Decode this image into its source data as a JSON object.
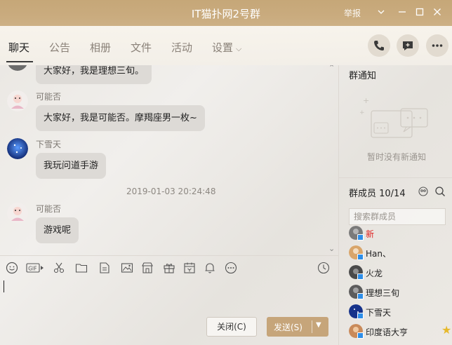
{
  "window": {
    "title": "IT猫扑网2号群",
    "report_label": "举报",
    "accent": "#c6a778"
  },
  "tabs": [
    {
      "label": "聊天",
      "active": true
    },
    {
      "label": "公告"
    },
    {
      "label": "相册"
    },
    {
      "label": "文件"
    },
    {
      "label": "活动"
    },
    {
      "label": "设置"
    }
  ],
  "header_actions": [
    "phone-icon",
    "add-chat-icon",
    "more-icon"
  ],
  "messages": [
    {
      "sender": "",
      "text": "大家好，我是理想三旬。"
    },
    {
      "sender": "可能否",
      "text": "大家好，我是可能否。摩羯座男一枚~"
    },
    {
      "sender": "下雪天",
      "text": "我玩问道手游"
    },
    {
      "timestamp": "2019-01-03 20:24:48"
    },
    {
      "sender": "可能否",
      "text": "游戏呢"
    }
  ],
  "composer": {
    "tools": [
      "emoji-icon",
      "gif-icon",
      "scissors-icon",
      "folder-icon",
      "doc-icon",
      "image-icon",
      "shop-icon",
      "gift-icon",
      "calendar-icon",
      "bell-icon",
      "more-dots-icon"
    ],
    "close_label": "关闭(C)",
    "send_label": "发送(S)"
  },
  "notice": {
    "title": "群通知",
    "empty_text": "暂时没有新通知"
  },
  "members": {
    "title": "群成员 10/14",
    "search_placeholder": "搜索群成员",
    "list": [
      {
        "name": "新",
        "highlight": true
      },
      {
        "name": "Han、"
      },
      {
        "name": "火龙"
      },
      {
        "name": "理想三旬"
      },
      {
        "name": "下雪天"
      },
      {
        "name": "印度语大亨",
        "starred": true
      }
    ]
  }
}
